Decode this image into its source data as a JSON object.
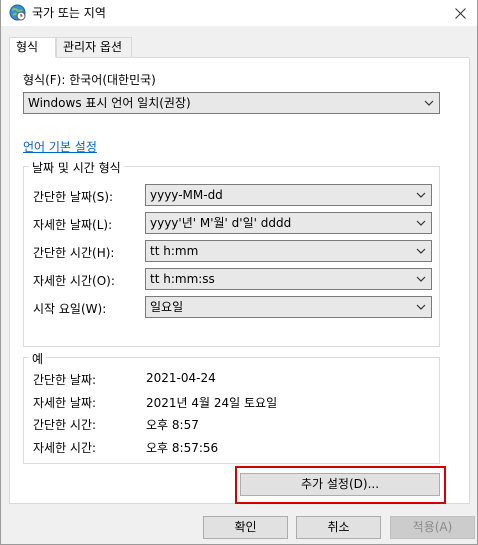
{
  "window": {
    "title": "국가 또는 지역",
    "close_glyph": "✕"
  },
  "tabs": [
    {
      "label": "형식",
      "active": true
    },
    {
      "label": "관리자 옵션",
      "active": false
    }
  ],
  "format": {
    "label": "형식(F): 한국어(대한민국)",
    "value": "Windows 표시 언어 일치(권장)"
  },
  "language_link": "언어 기본 설정",
  "date_time_group": {
    "caption": "날짜 및 시간 형식",
    "rows": [
      {
        "label": "간단한 날짜(S):",
        "value": "yyyy-MM-dd"
      },
      {
        "label": "자세한 날짜(L):",
        "value": "yyyy'년' M'월' d'일' dddd"
      },
      {
        "label": "간단한 시간(H):",
        "value": "tt h:mm"
      },
      {
        "label": "자세한 시간(O):",
        "value": "tt h:mm:ss"
      },
      {
        "label": "시작 요일(W):",
        "value": "일요일"
      }
    ]
  },
  "example_group": {
    "caption": "예",
    "rows": [
      {
        "label": "간단한 날짜:",
        "value": "2021-04-24"
      },
      {
        "label": "자세한 날짜:",
        "value": "2021년 4월 24일 토요일"
      },
      {
        "label": "간단한 시간:",
        "value": "오후 8:57"
      },
      {
        "label": "자세한 시간:",
        "value": "오후 8:57:56"
      }
    ]
  },
  "additional_settings_button": "추가 설정(D)...",
  "footer": {
    "ok": "확인",
    "cancel": "취소",
    "apply": "적용(A)"
  },
  "colors": {
    "highlight_border": "#d40000",
    "link": "#0066cc"
  }
}
